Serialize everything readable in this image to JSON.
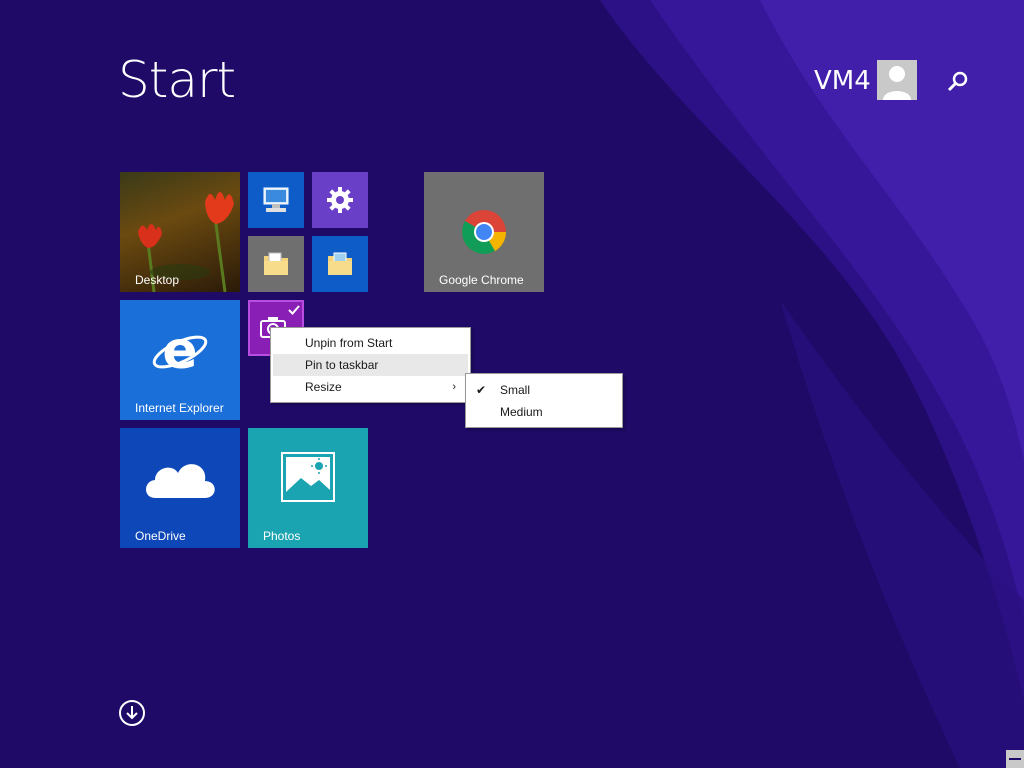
{
  "header": {
    "title": "Start",
    "user_name": "VM4"
  },
  "tiles": {
    "desktop": "Desktop",
    "chrome": "Google Chrome",
    "ie": "Internet Explorer",
    "onedrive": "OneDrive",
    "photos": "Photos"
  },
  "context_menu": {
    "items": [
      "Unpin from Start",
      "Pin to taskbar",
      "Resize"
    ],
    "hovered": "Pin to taskbar"
  },
  "resize_submenu": {
    "items": [
      "Small",
      "Medium"
    ],
    "selected": "Small"
  },
  "icons": {
    "search": "search-icon",
    "all_apps": "down-arrow-circle-icon",
    "settings": "gear-icon",
    "this_pc": "computer-icon",
    "file_explorer": "folder-icon",
    "camera": "camera-icon"
  },
  "colors": {
    "background": "#1f0a68",
    "tile_blue": "#1b6fd9",
    "tile_dark_blue": "#0d47b8",
    "tile_purple": "#6a3fc8",
    "tile_gray": "#6f6f6f",
    "tile_teal": "#1aa3b0",
    "tile_magenta": "#8a1fb5"
  }
}
